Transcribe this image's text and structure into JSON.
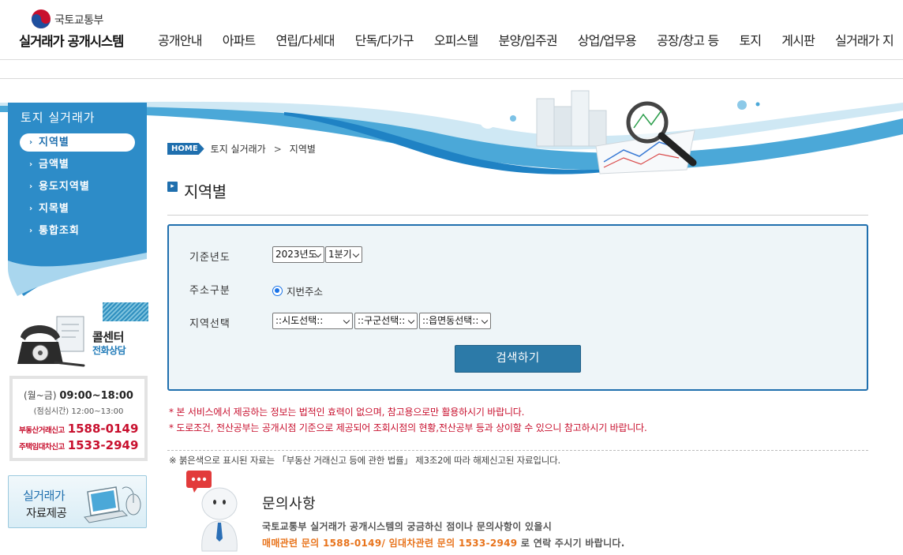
{
  "header": {
    "ministry": "국토교통부",
    "system_name": "실거래가 공개시스템",
    "nav": [
      "공개안내",
      "아파트",
      "연립/다세대",
      "단독/다가구",
      "오피스텔",
      "분양/입주권",
      "상업/업무용",
      "공장/창고 등",
      "토지",
      "게시판",
      "실거래가 지"
    ]
  },
  "sidebar": {
    "title": "토지 실거래가",
    "items": [
      {
        "label": "지역별",
        "active": true
      },
      {
        "label": "금액별",
        "active": false
      },
      {
        "label": "용도지역별",
        "active": false
      },
      {
        "label": "지목별",
        "active": false
      },
      {
        "label": "통합조회",
        "active": false
      }
    ],
    "call_center": {
      "title": "콜센터",
      "subtitle": "전화상담"
    },
    "hours": {
      "days": "(월~금)",
      "time": "09:00~18:00",
      "lunch": "(점심시간) 12:00~13:00",
      "trade_label": "부동산거래신고",
      "trade_phone": "1588-0149",
      "lease_label": "주택임대차신고",
      "lease_phone": "1533-2949"
    },
    "data_provision": {
      "line1": "실거래가",
      "line2": "자료제공"
    }
  },
  "breadcrumb": {
    "home": "HOME",
    "section": "토지 실거래가",
    "current": "지역별"
  },
  "page_title": "지역별",
  "search": {
    "year_label": "기준년도",
    "year_value": "2023년도",
    "quarter_value": "1분기",
    "address_label": "주소구분",
    "address_option": "지번주소",
    "region_label": "지역선택",
    "sido": "::시도선택::",
    "sigungu": "::구군선택::",
    "eupmyeondong": "::읍면동선택::",
    "button": "검색하기"
  },
  "notices": {
    "n1": "* 본 서비스에서 제공하는 정보는 법적인 효력이 없으며, 참고용으로만 활용하시기 바랍니다.",
    "n2": "* 도로조건, 전산공부는 공개시점 기준으로 제공되어 조회시점의 현황,전산공부 등과 상이할 수 있으니 참고하시기 바랍니다.",
    "legal": "※ 붉은색으로 표시된 자료는 「부동산 거래신고 등에 관한 법률」 제3조2에 따라 해제신고된 자료입니다."
  },
  "inquiry": {
    "title": "문의사항",
    "line1": "국토교통부 실거래가 공개시스템의 궁금하신 점이나 문의사항이 있을시",
    "line2_highlight": "매매관련 문의 1588-0149/ 임대차관련 문의 1533-2949",
    "line2_rest": " 로 연락 주시기 바랍니다."
  },
  "colors": {
    "primary": "#1f6fae",
    "accent": "#2c7aa8",
    "notice": "#c8102e",
    "highlight": "#e8731b"
  }
}
